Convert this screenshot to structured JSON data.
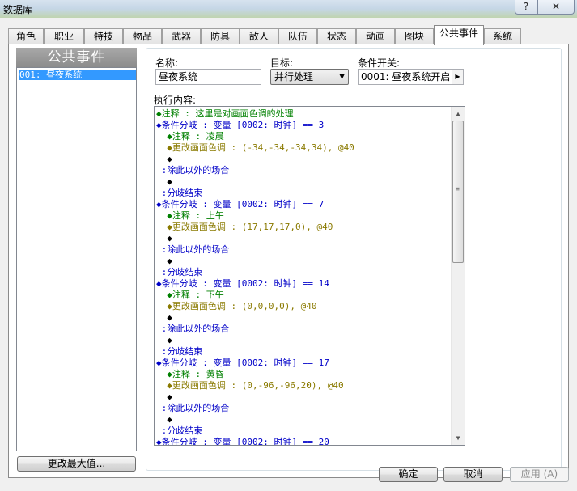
{
  "window": {
    "title": "数据库",
    "help_label": "?",
    "close_label": "✕"
  },
  "tabs": [
    {
      "label": "角色"
    },
    {
      "label": "职业"
    },
    {
      "label": "特技"
    },
    {
      "label": "物品"
    },
    {
      "label": "武器"
    },
    {
      "label": "防具"
    },
    {
      "label": "敌人"
    },
    {
      "label": "队伍"
    },
    {
      "label": "状态"
    },
    {
      "label": "动画"
    },
    {
      "label": "图块"
    },
    {
      "label": "公共事件"
    },
    {
      "label": "系统"
    }
  ],
  "active_tab": "公共事件",
  "event_list": {
    "header": "公共事件",
    "items": [
      {
        "label": "001: 昼夜系统",
        "selected": true
      }
    ],
    "change_max_button": "更改最大值..."
  },
  "form": {
    "name_label": "名称:",
    "name_value": "昼夜系统",
    "trigger_label": "目标:",
    "trigger_value": "并行处理",
    "switch_label": "条件开关:",
    "switch_value": "0001: 昼夜系统开启",
    "contents_label": "执行内容:"
  },
  "commands": [
    {
      "text": "◆注释 : 这里是对画面色调的处理",
      "kind": "comment"
    },
    {
      "text": "◆条件分岐 : 变量 [0002: 时钟] == 3",
      "kind": "branch"
    },
    {
      "text": "  ◆注释 : 凌晨",
      "kind": "comment"
    },
    {
      "text": "  ◆更改画面色调 : (-34,-34,-34,34), @40",
      "kind": "tint"
    },
    {
      "text": "  ◆",
      "kind": "black"
    },
    {
      "text": " :除此以外的场合",
      "kind": "branch"
    },
    {
      "text": "  ◆",
      "kind": "black"
    },
    {
      "text": " :分歧结束",
      "kind": "branch"
    },
    {
      "text": "◆条件分岐 : 变量 [0002: 时钟] == 7",
      "kind": "branch"
    },
    {
      "text": "  ◆注释 : 上午",
      "kind": "comment"
    },
    {
      "text": "  ◆更改画面色调 : (17,17,17,0), @40",
      "kind": "tint"
    },
    {
      "text": "  ◆",
      "kind": "black"
    },
    {
      "text": " :除此以外的场合",
      "kind": "branch"
    },
    {
      "text": "  ◆",
      "kind": "black"
    },
    {
      "text": " :分歧结束",
      "kind": "branch"
    },
    {
      "text": "◆条件分岐 : 变量 [0002: 时钟] == 14",
      "kind": "branch"
    },
    {
      "text": "  ◆注释 : 下午",
      "kind": "comment"
    },
    {
      "text": "  ◆更改画面色调 : (0,0,0,0), @40",
      "kind": "tint"
    },
    {
      "text": "  ◆",
      "kind": "black"
    },
    {
      "text": " :除此以外的场合",
      "kind": "branch"
    },
    {
      "text": "  ◆",
      "kind": "black"
    },
    {
      "text": " :分歧结束",
      "kind": "branch"
    },
    {
      "text": "◆条件分岐 : 变量 [0002: 时钟] == 17",
      "kind": "branch"
    },
    {
      "text": "  ◆注释 : 黄昏",
      "kind": "comment"
    },
    {
      "text": "  ◆更改画面色调 : (0,-96,-96,20), @40",
      "kind": "tint"
    },
    {
      "text": "  ◆",
      "kind": "black"
    },
    {
      "text": " :除此以外的场合",
      "kind": "branch"
    },
    {
      "text": "  ◆",
      "kind": "black"
    },
    {
      "text": " :分歧结束",
      "kind": "branch"
    },
    {
      "text": "◆条件分岐 : 变量 [0002: 时钟] == 20",
      "kind": "branch"
    }
  ],
  "footer": {
    "ok": "确定",
    "cancel": "取消",
    "apply": "应用 (A)"
  },
  "colors": {
    "comment": "#008000",
    "branch": "#0000c8",
    "tint": "#8a7a00",
    "selection": "#3399ff"
  }
}
